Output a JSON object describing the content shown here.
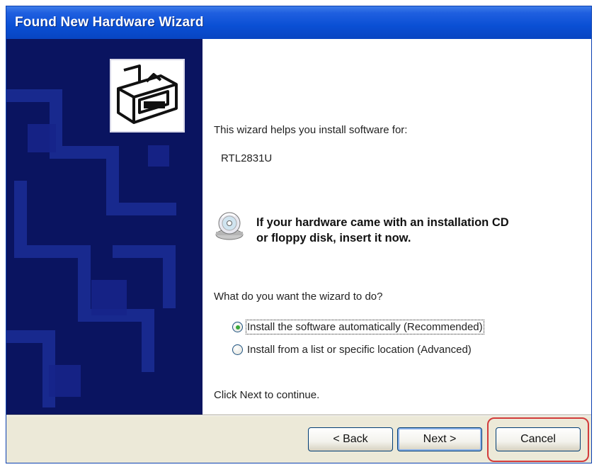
{
  "window": {
    "title": "Found New Hardware Wizard"
  },
  "content": {
    "intro": "This wizard helps you install software for:",
    "device_name": "RTL2831U",
    "cd_message_line1": "If your hardware came with an installation CD",
    "cd_message_line2": "or floppy disk, insert it now.",
    "question": "What do you want the wizard to do?",
    "options": [
      {
        "label": "Install the software automatically (Recommended)",
        "selected": true
      },
      {
        "label": "Install from a list or specific location (Advanced)",
        "selected": false
      }
    ],
    "footer_hint": "Click Next to continue."
  },
  "buttons": {
    "back": "< Back",
    "next": "Next >",
    "cancel": "Cancel"
  },
  "colors": {
    "title_bar": "#0a4fd4",
    "left_panel": "#0a1460",
    "highlight_ring": "#d23b3b"
  },
  "icons": {
    "hardware": "hardware-icon",
    "cd": "cd-icon"
  }
}
